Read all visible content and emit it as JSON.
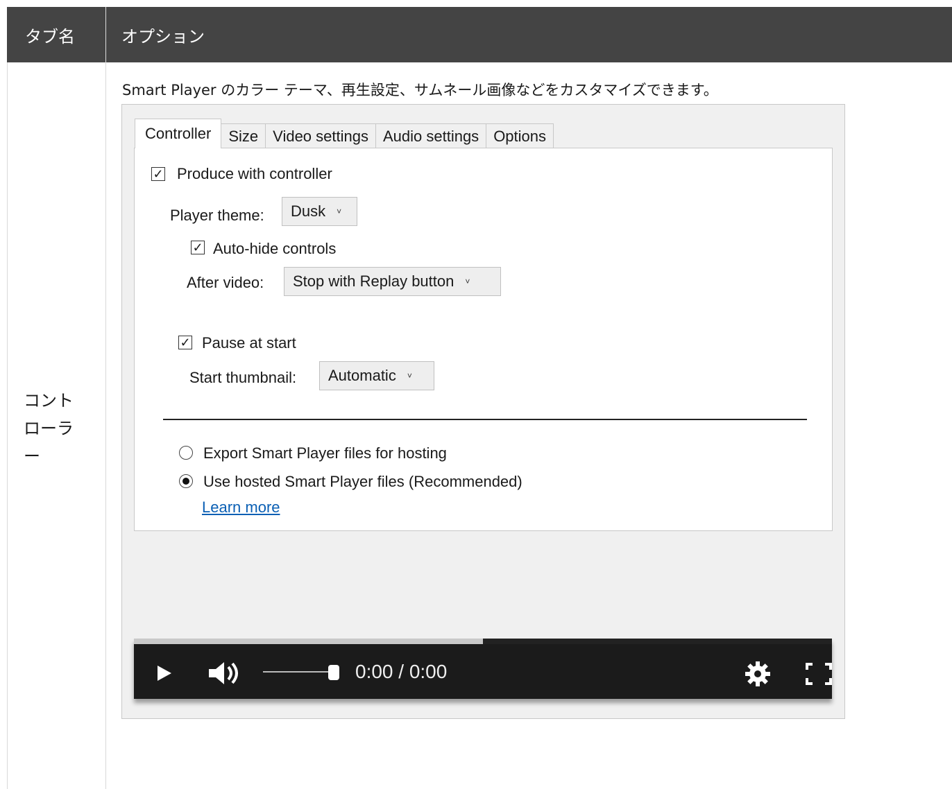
{
  "table": {
    "header_col1": "タブ名",
    "header_col2": "オプション",
    "row_label": "コントローラー",
    "description": "Smart Player のカラー テーマ、再生設定、サムネール画像などをカスタマイズできます。"
  },
  "tabs": [
    {
      "label": "Controller",
      "active": true
    },
    {
      "label": "Size",
      "active": false
    },
    {
      "label": "Video settings",
      "active": false
    },
    {
      "label": "Audio settings",
      "active": false
    },
    {
      "label": "Options",
      "active": false
    }
  ],
  "controller": {
    "produce_with_controller": {
      "label": "Produce with controller",
      "checked": true
    },
    "player_theme": {
      "label": "Player theme:",
      "value": "Dusk"
    },
    "auto_hide": {
      "label": "Auto-hide controls",
      "checked": true
    },
    "after_video": {
      "label": "After video:",
      "value": "Stop with Replay button"
    },
    "pause_at_start": {
      "label": "Pause at start",
      "checked": true
    },
    "start_thumbnail": {
      "label": "Start thumbnail:",
      "value": "Automatic"
    },
    "export_option": {
      "label": "Export Smart Player files for hosting",
      "selected": false
    },
    "hosted_option": {
      "label": "Use hosted Smart Player files (Recommended)",
      "selected": true
    },
    "learn_more": "Learn more"
  },
  "player": {
    "time": "0:00 / 0:00",
    "progress_fraction": 0.5
  },
  "colors": {
    "header_bg": "#444444",
    "link": "#0a5fb4",
    "player_bg": "#1b1b1b"
  }
}
